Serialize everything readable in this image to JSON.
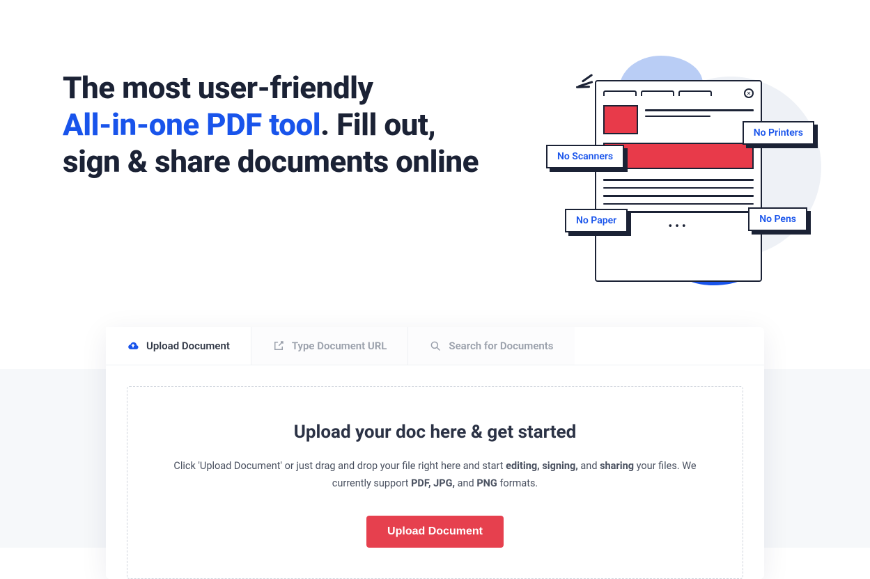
{
  "hero": {
    "line1": "The most user-friendly",
    "highlight": "All-in-one PDF tool",
    "line2_after": ". Fill out,",
    "line3": "sign & share documents online"
  },
  "illustration": {
    "callouts": {
      "scanners": "No Scanners",
      "printers": "No Printers",
      "paper": "No Paper",
      "pens": "No Pens"
    }
  },
  "tabs": {
    "upload": "Upload Document",
    "url": "Type Document URL",
    "search": "Search for Documents"
  },
  "dropzone": {
    "heading": "Upload your doc here & get started",
    "text_pre": "Click 'Upload Document' or just drag and drop your file right here and start ",
    "bold_editing": "editing,",
    "mid1": " ",
    "bold_signing": "signing,",
    "mid2": " and ",
    "bold_sharing": "sharing",
    "mid3": " your files. We currently support ",
    "bold_pdf": "PDF,",
    "mid4": " ",
    "bold_jpg": "JPG,",
    "mid5": " and ",
    "bold_png": "PNG",
    "text_post": " formats.",
    "button": "Upload Document"
  }
}
